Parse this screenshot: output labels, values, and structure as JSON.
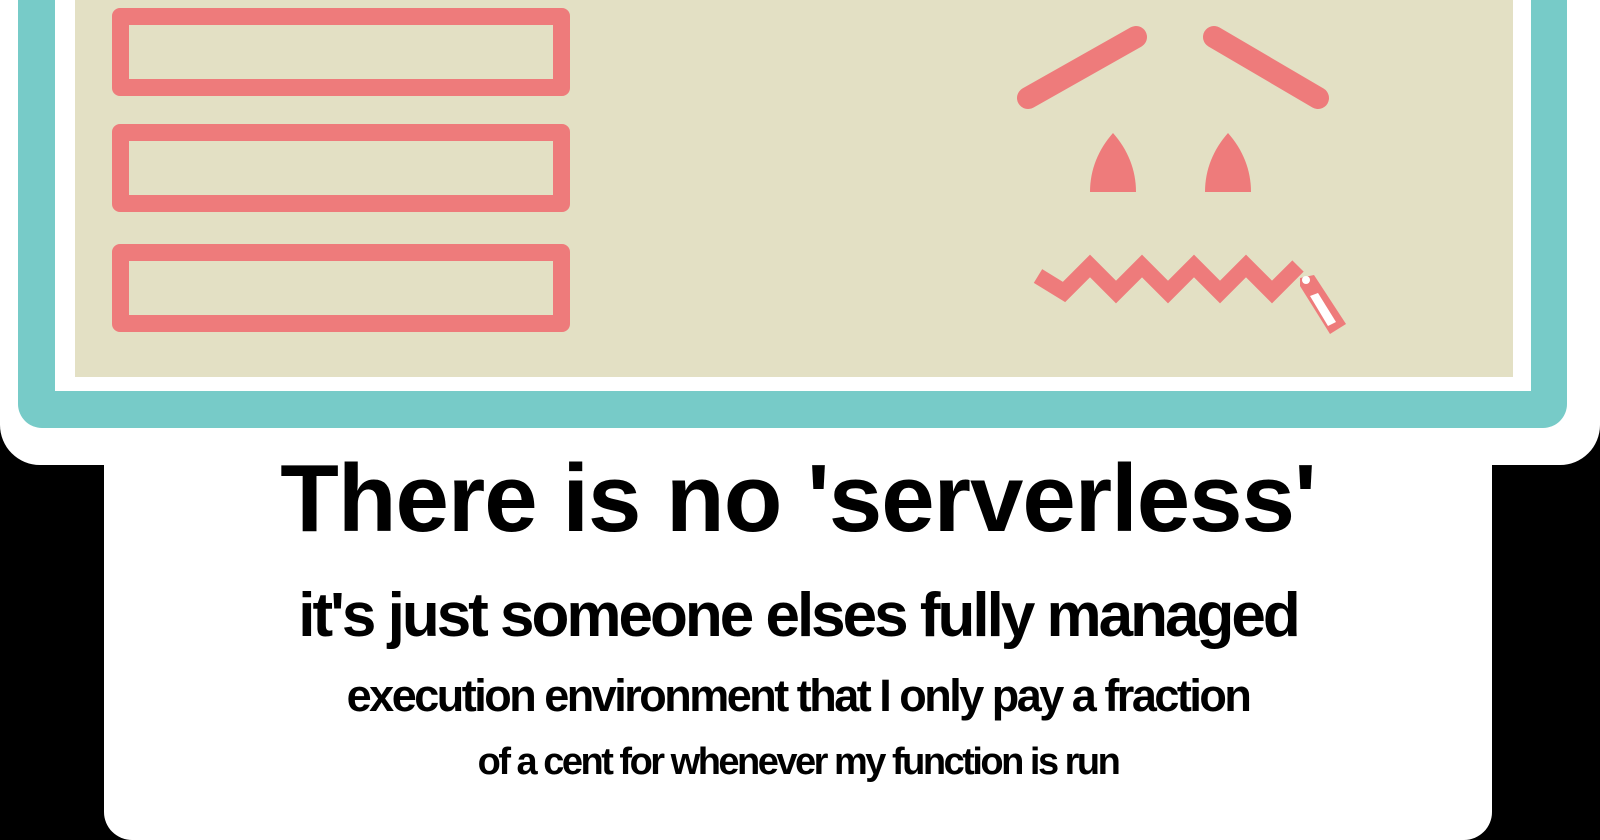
{
  "colors": {
    "background": "#000000",
    "sticker": "#ffffff",
    "frame": "#77cbc8",
    "panel": "#e3e0c4",
    "accent": "#ee7b7b",
    "text": "#000000"
  },
  "illustration": {
    "server_slots": 3,
    "face": {
      "icon": "sad-face-icon",
      "mouth": "zipper-mouth-icon"
    }
  },
  "caption": {
    "line1": "There is no 'serverless'",
    "line2": "it's just someone elses fully managed",
    "line3": "execution environment that I only pay a fraction",
    "line4": "of a cent for whenever my function is run"
  }
}
